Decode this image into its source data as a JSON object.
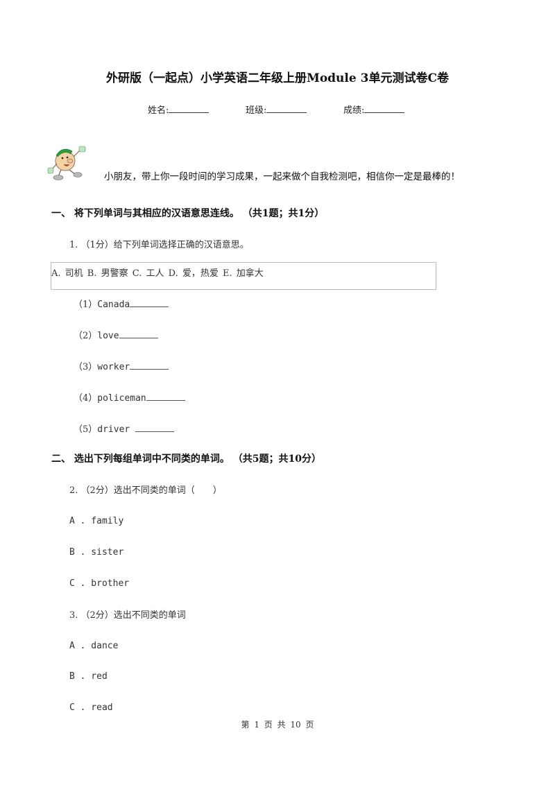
{
  "header": {
    "title": "外研版（一起点）小学英语二年级上册Module 3单元测试卷C卷",
    "fields": [
      {
        "label": "姓名:",
        "value": "________"
      },
      {
        "label": "班级:",
        "value": "________"
      },
      {
        "label": "成绩:",
        "value": "________"
      }
    ]
  },
  "intro": {
    "mascot_icon": "cartoon-boy-mascot",
    "text": "小朋友，带上你一段时间的学习成果，一起来做个自我检测吧，相信你一定是最棒的！"
  },
  "sections": [
    {
      "heading": "一、  将下列单词与其相应的汉语意思连线。 （共1题；共1分）",
      "questions": [
        {
          "stem": "1.  （1分）给下列单词选择正确的汉语意思。",
          "choices": "A. 司机   B. 男警察   C. 工人   D. 爱，热爱   E. 加拿大",
          "items": [
            {
              "num": "（1）",
              "word": "Canada",
              "blank": "________"
            },
            {
              "num": "（2）",
              "word": "love",
              "blank": "________"
            },
            {
              "num": "（3）",
              "word": "worker",
              "blank": "________"
            },
            {
              "num": "（4）",
              "word": "policeman",
              "blank": "________"
            },
            {
              "num": "（5）",
              "word": "driver ",
              "blank": "________"
            }
          ]
        }
      ]
    },
    {
      "heading": "二、  选出下列每组单词中不同类的单词。 （共5题；共10分）",
      "questions": [
        {
          "stem": "2.  （2分）选出不同类的单词（　　）",
          "options": [
            "A . family",
            "B . sister",
            "C . brother"
          ]
        },
        {
          "stem": "3.  （2分）选出不同类的单词",
          "options": [
            "A . dance",
            "B . red",
            "C . read"
          ]
        }
      ]
    }
  ],
  "footer": {
    "page_text": "第 1 页 共 10 页"
  }
}
